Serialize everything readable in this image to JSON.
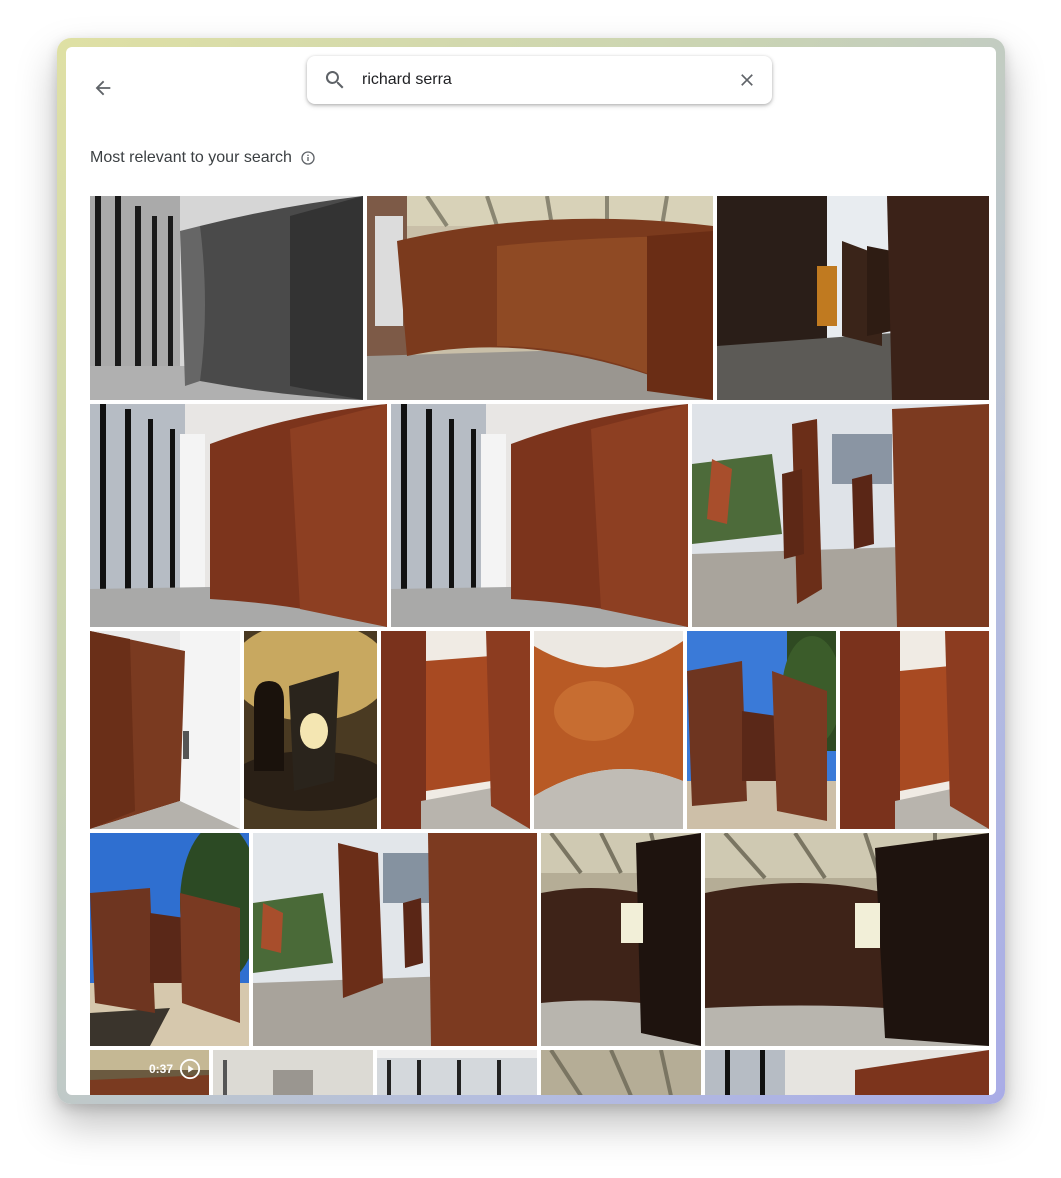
{
  "search": {
    "query": "richard serra",
    "clear_label": "×"
  },
  "section": {
    "title": "Most relevant to your search"
  },
  "video": {
    "duration": "0:37"
  },
  "colors": {
    "rust": "#8a3a1f",
    "dark_steel": "#2b1b14",
    "floor": "#b8b4ad",
    "sky": "#3a78d6"
  },
  "icons": {
    "back": "arrow-left-icon",
    "search": "magnifier-icon",
    "clear": "close-icon",
    "info": "info-icon",
    "play": "play-icon"
  }
}
